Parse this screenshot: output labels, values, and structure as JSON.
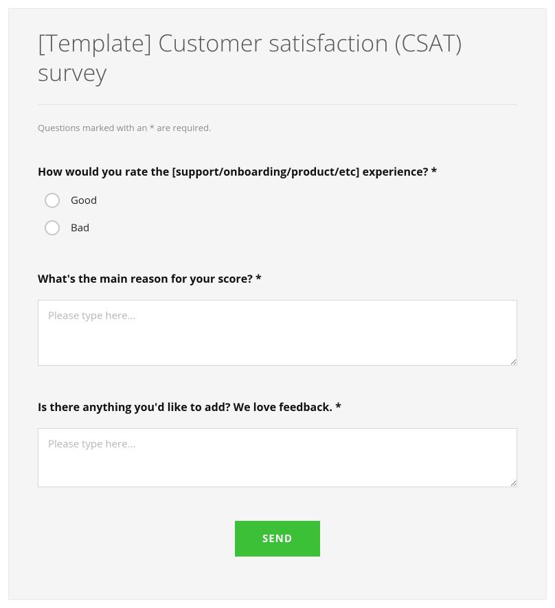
{
  "survey": {
    "title": "[Template] Customer satisfaction (CSAT) survey",
    "required_note": "Questions marked with an * are required.",
    "q1": {
      "label": "How would you rate the [support/onboarding/product/etc] experience? *",
      "options": [
        "Good",
        "Bad"
      ]
    },
    "q2": {
      "label": "What's the main reason for your score? *",
      "placeholder": "Please type here..."
    },
    "q3": {
      "label": "Is there anything you'd like to add? We love feedback. *",
      "placeholder": "Please type here..."
    },
    "submit_label": "SEND"
  },
  "colors": {
    "accent": "#3bc038",
    "card_bg": "#f5f5f5",
    "text_muted": "#8c8c8c"
  }
}
